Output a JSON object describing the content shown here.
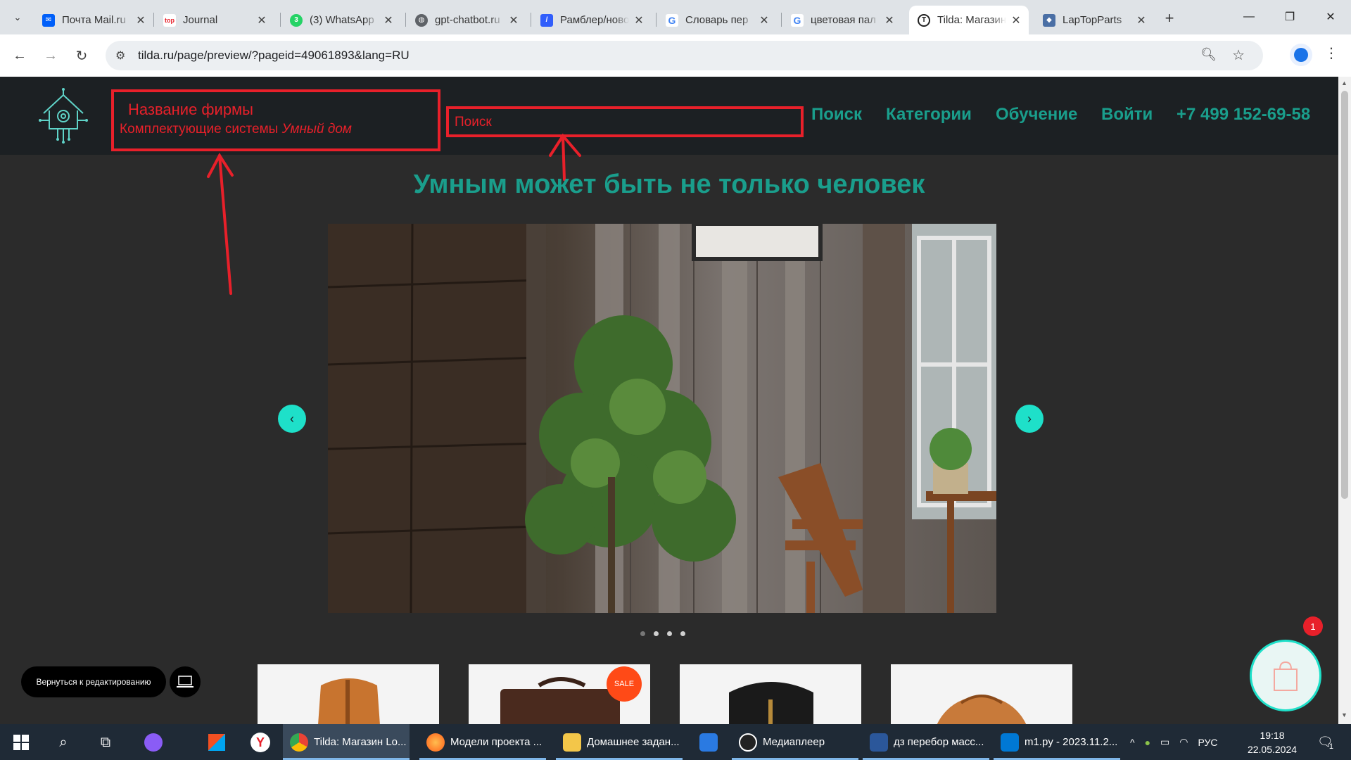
{
  "browser": {
    "tabs": [
      {
        "title": "Почта Mail.ru",
        "icon": "mail-icon",
        "color": "#005ff9",
        "active": false
      },
      {
        "title": "Journal",
        "icon": "top-icon",
        "color": "#e8202a",
        "active": false
      },
      {
        "title": "(3) WhatsApp",
        "icon": "whatsapp-icon",
        "color": "#25d366",
        "active": false
      },
      {
        "title": "gpt-chatbot.ru",
        "icon": "globe-icon",
        "color": "#5f6368",
        "active": false
      },
      {
        "title": "Рамблер/новости",
        "icon": "rambler-icon",
        "color": "#315efb",
        "active": false
      },
      {
        "title": "Словарь пер",
        "icon": "google-icon",
        "color": "#4285f4",
        "active": false
      },
      {
        "title": "цветовая пал",
        "icon": "google-icon",
        "color": "#4285f4",
        "active": false
      },
      {
        "title": "Tilda: Магазин",
        "icon": "tilda-icon",
        "color": "#222222",
        "active": true
      },
      {
        "title": "LapTopParts",
        "icon": "shield-icon",
        "color": "#4a6fa5",
        "active": false
      }
    ],
    "new_tab_symbol": "+",
    "window_controls": {
      "minimize": "—",
      "restore": "❐",
      "close": "✕"
    },
    "url": "tilda.ru/page/preview/?pageid=49061893&lang=RU"
  },
  "site": {
    "brand": {
      "name": "Название фирмы",
      "tagline": "Комплектующие системы ",
      "tagline_italic": "Умный дом"
    },
    "search_label": "Поиск",
    "menu": [
      "Поиск",
      "Категории",
      "Обучение",
      "Войти",
      "+7 499 152-69-58"
    ],
    "hero_title": "Умным может быть не только человек",
    "slider": {
      "slide_count": 4,
      "active_slide": 1,
      "prev": "‹",
      "next": "›"
    },
    "products": [
      {
        "name": "orange-backpack",
        "sale": false
      },
      {
        "name": "brown-bag",
        "sale": true
      },
      {
        "name": "black-backpack",
        "sale": false
      },
      {
        "name": "round-orange-bag",
        "sale": false
      }
    ],
    "sale_label": "SALE",
    "back_to_edit": "Вернуться к редактированию",
    "cart_count": "1",
    "colors": {
      "accent": "#1a9e8c",
      "annotation": "#e8202a",
      "arrow_button": "#1ee0c9",
      "header_bg": "#1c2023",
      "page_bg": "#2b2b2b"
    }
  },
  "taskbar": {
    "apps": [
      {
        "label": "Tilda: Магазин Lo...",
        "icon": "chrome-icon",
        "active": true
      },
      {
        "label": "Модели проекта ...",
        "icon": "firefox-icon",
        "active": false
      },
      {
        "label": "Домашнее задан...",
        "icon": "folder-icon",
        "active": false
      },
      {
        "label": "",
        "icon": "mail-app-icon",
        "active": false
      },
      {
        "label": "Медиаплеер",
        "icon": "media-player-icon",
        "active": false
      },
      {
        "label": "дз перебор масс...",
        "icon": "word-icon",
        "active": false
      },
      {
        "label": "m1.py - 2023.11.2...",
        "icon": "vscode-icon",
        "active": false
      }
    ],
    "language": "РУС",
    "time": "19:18",
    "date": "22.05.2024",
    "notifications": "1"
  }
}
